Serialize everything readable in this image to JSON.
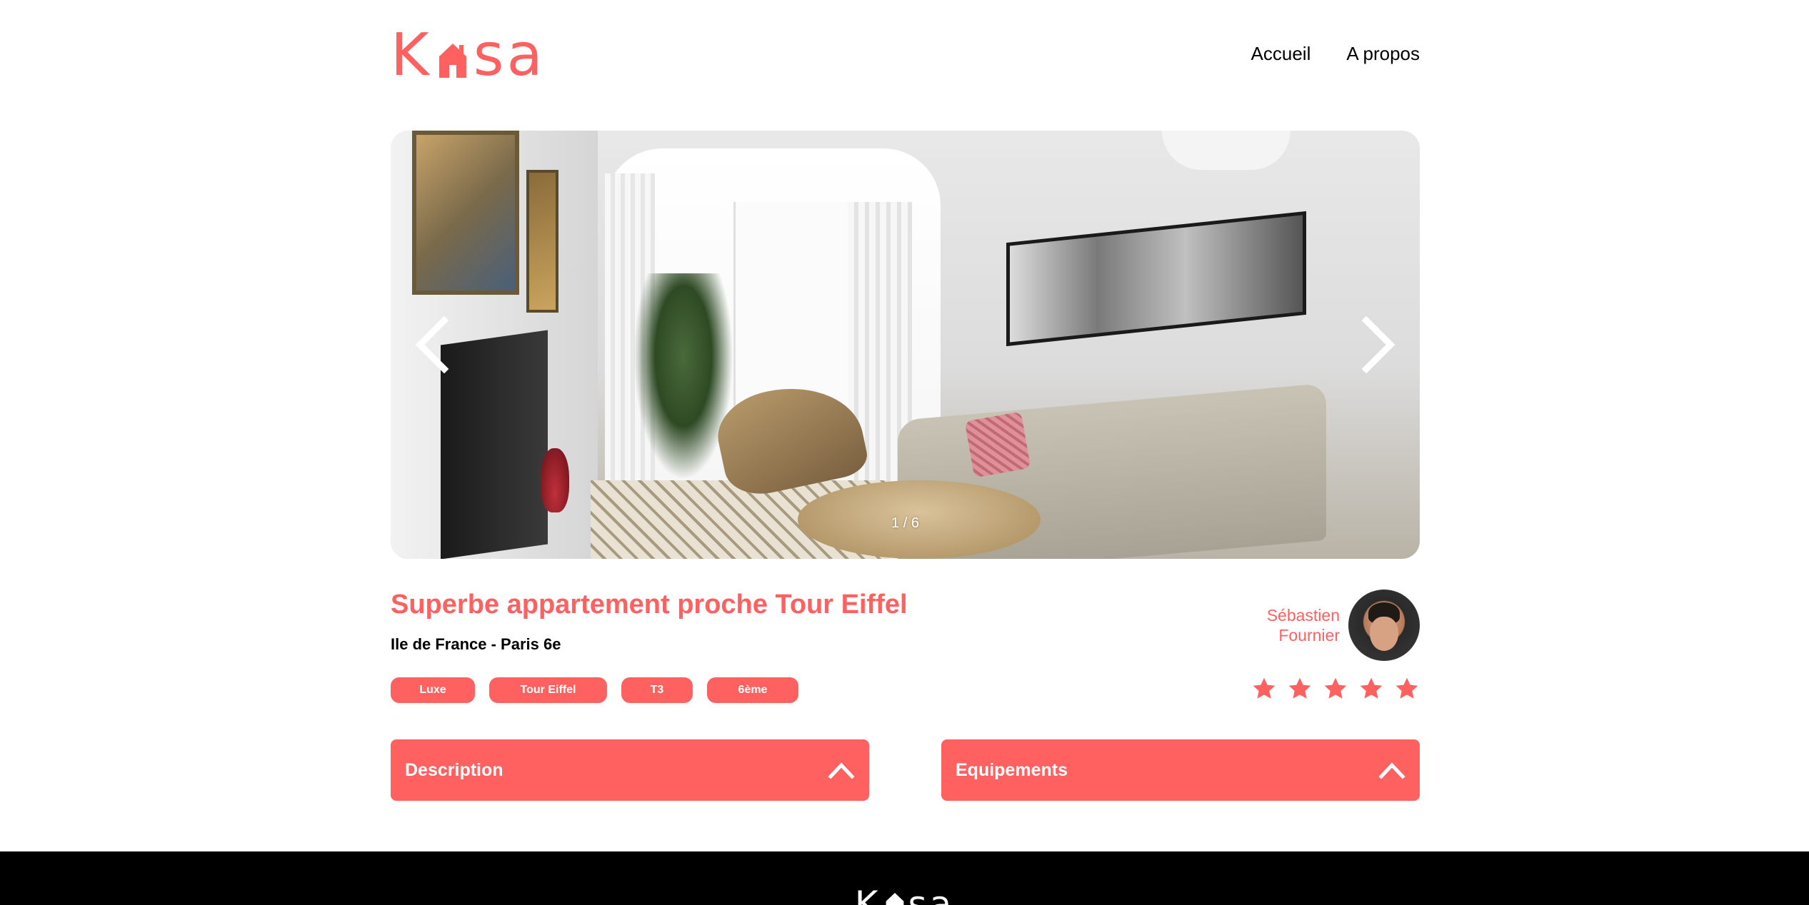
{
  "brand": {
    "logo_text": "Kasa",
    "logo_before": "K",
    "logo_after": "sa",
    "accent_color": "#FF6060"
  },
  "nav": {
    "home": "Accueil",
    "about": "A propos"
  },
  "gallery": {
    "counter": "1 / 6",
    "prev_icon": "chevron-left-icon",
    "next_icon": "chevron-right-icon"
  },
  "listing": {
    "title": "Superbe appartement proche Tour Eiffel",
    "location": "Ile de France - Paris 6e",
    "tags": [
      "Luxe",
      "Tour Eiffel",
      "T3",
      "6ème"
    ]
  },
  "host": {
    "first_name": "Sébastien",
    "last_name": "Fournier"
  },
  "rating": {
    "value": 5,
    "max": 5
  },
  "collapses": {
    "description": "Description",
    "equipments": "Equipements"
  },
  "footer": {
    "logo_before": "K",
    "logo_after": "sa"
  }
}
